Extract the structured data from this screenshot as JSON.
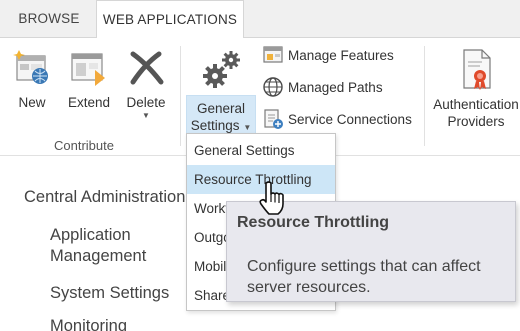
{
  "tabs": [
    {
      "label": "BROWSE"
    },
    {
      "label": "WEB APPLICATIONS"
    }
  ],
  "ribbon": {
    "contribute": {
      "new_label": "New",
      "extend_label": "Extend",
      "delete_label": "Delete",
      "group_label": "Contribute"
    },
    "general_settings": {
      "line1": "General",
      "line2": "Settings"
    },
    "small_buttons": [
      {
        "label": "Manage Features",
        "icon": "manage-features-icon"
      },
      {
        "label": "Managed Paths",
        "icon": "globe-icon"
      },
      {
        "label": "Service Connections",
        "icon": "service-connections-icon"
      }
    ],
    "auth": {
      "line1": "Authentication",
      "line2": "Providers"
    }
  },
  "nav": [
    "Central Administration",
    "Application",
    "Management",
    "System Settings",
    "Monitoring"
  ],
  "dropdown": {
    "items": [
      "General Settings",
      "Resource Throttling",
      "Workflow",
      "Outgoing",
      "Mobile",
      "SharePoint"
    ]
  },
  "tooltip": {
    "title": "Resource Throttling",
    "description": "Configure settings that can affect server resources."
  }
}
